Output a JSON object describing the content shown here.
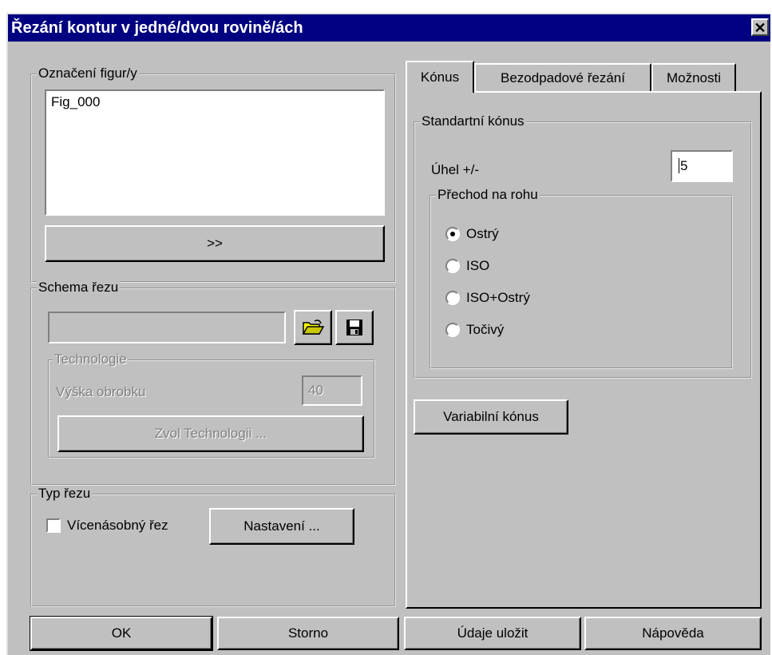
{
  "window": {
    "title": "Řezání kontur v jedné/dvou rovině/ách",
    "close_label": "✕"
  },
  "figures": {
    "legend": "Označení figur/y",
    "items": [
      "Fig_000"
    ],
    "more_label": ">>"
  },
  "scheme": {
    "legend": "Schema řezu",
    "value": "",
    "technology": {
      "legend": "Technologie",
      "height_label": "Výška obrobku",
      "height_value": "40",
      "choose_label": "Zvol Technologii ..."
    }
  },
  "cut_type": {
    "legend": "Typ řezu",
    "multi_label": "Vícenásobný řez",
    "multi_checked": false,
    "settings_label": "Nastavení ..."
  },
  "tabs": [
    {
      "label": "Kónus"
    },
    {
      "label": "Bezodpadové řezání"
    },
    {
      "label": "Možnosti"
    }
  ],
  "cone": {
    "legend": "Standartní kónus",
    "angle_label": "Úhel +/-",
    "angle_value": "5",
    "corner": {
      "legend": "Přechod na rohu",
      "options": [
        "Ostrý",
        "ISO",
        "ISO+Ostrý",
        "Točivý"
      ],
      "selected": "Ostrý"
    },
    "variable_label": "Variabilní kónus"
  },
  "footer": {
    "ok": "OK",
    "cancel": "Storno",
    "save": "Údaje uložit",
    "help": "Nápověda"
  }
}
